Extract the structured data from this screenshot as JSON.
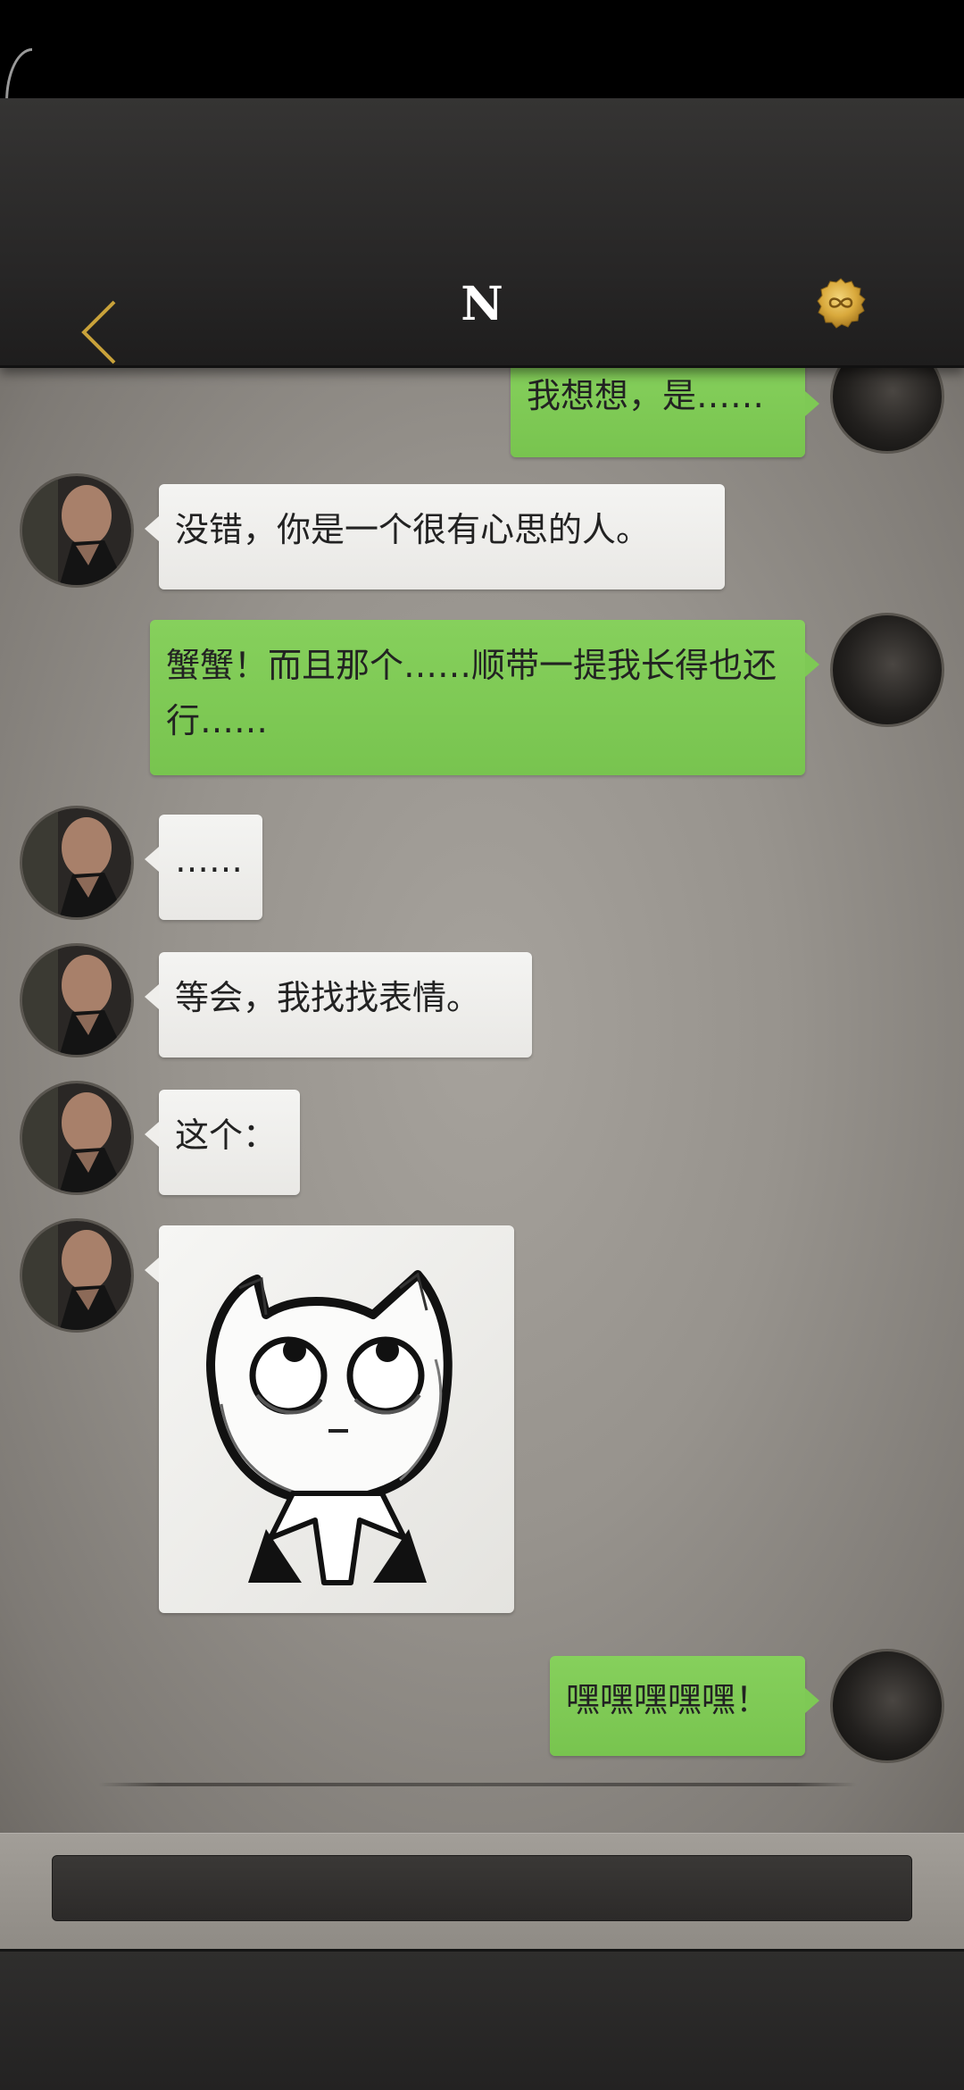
{
  "header": {
    "title": "N",
    "back_icon": "chevron-left-icon",
    "seal_icon": "infinity-seal-icon",
    "accent_color": "#c9a23a"
  },
  "messages": [
    {
      "side": "out",
      "text": "我想想，是……"
    },
    {
      "side": "in",
      "text": "没错，你是一个很有心思的人。"
    },
    {
      "side": "out",
      "text": "蟹蟹！而且那个……顺带一提我长得也还行……"
    },
    {
      "side": "in",
      "text": "……"
    },
    {
      "side": "in",
      "text": "等会，我找找表情。"
    },
    {
      "side": "in",
      "text": "这个："
    },
    {
      "side": "in",
      "type": "sticker",
      "sticker": "cartoon-cat-sticker"
    },
    {
      "side": "out",
      "text": "嘿嘿嘿嘿嘿！"
    }
  ],
  "input": {
    "value": "",
    "placeholder": ""
  },
  "colors": {
    "outgoing_bubble": "#7ec955",
    "incoming_bubble": "#efeeeb"
  }
}
